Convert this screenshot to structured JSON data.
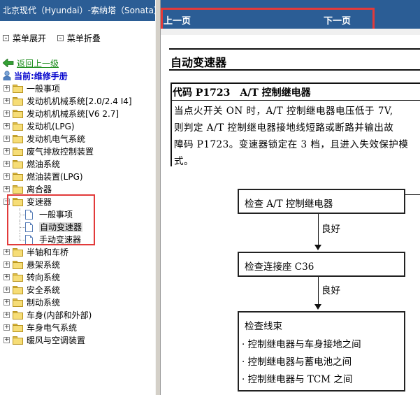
{
  "left_pane": {
    "title": "北京现代（Hyundai）-索纳塔（Sonata）-",
    "menu": {
      "expand_label": "菜单展开",
      "collapse_label": "菜单折叠"
    },
    "back_link": "返回上一级",
    "current_label": "当前:维修手册",
    "tree": [
      {
        "label": "一般事项",
        "expanded": false
      },
      {
        "label": "发动机机械系统[2.0/2.4 I4]",
        "expanded": false
      },
      {
        "label": "发动机机械系统[V6 2.7]",
        "expanded": false
      },
      {
        "label": "发动机(LPG)",
        "expanded": false
      },
      {
        "label": "发动机电气系统",
        "expanded": false
      },
      {
        "label": "废气排放控制装置",
        "expanded": false
      },
      {
        "label": "燃油系统",
        "expanded": false
      },
      {
        "label": "燃油装置(LPG)",
        "expanded": false
      },
      {
        "label": "离合器",
        "expanded": false
      },
      {
        "label": "变速器",
        "expanded": true,
        "children": [
          {
            "label": "一般事项",
            "selected": false
          },
          {
            "label": "自动变速器",
            "selected": true
          },
          {
            "label": "手动变速器",
            "selected": false
          }
        ]
      },
      {
        "label": "半轴和车桥",
        "expanded": false
      },
      {
        "label": "悬架系统",
        "expanded": false
      },
      {
        "label": "转向系统",
        "expanded": false
      },
      {
        "label": "安全系统",
        "expanded": false
      },
      {
        "label": "制动系统",
        "expanded": false
      },
      {
        "label": "车身(内部和外部)",
        "expanded": false
      },
      {
        "label": "车身电气系统",
        "expanded": false
      },
      {
        "label": "暖风与空调装置",
        "expanded": false
      }
    ]
  },
  "nav": {
    "prev_label": "上一页",
    "next_label": "下一页"
  },
  "document": {
    "section_title": "自动变速器",
    "code_title": "代码 P1723　A/T 控制继电器",
    "paragraph": [
      "当点火开关 ON 时，A/T 控制继电器电压低于 7V,",
      "则判定 A/T 控制继电器接地线短路或断路并输出故",
      "障码 P1723。变速器锁定在 3 档，且进入失效保护模",
      "式。"
    ],
    "flow": {
      "box1": "检查 A/T 控制继电器",
      "ok1": "良好",
      "box2": "检查连接座 C36",
      "ok2": "良好",
      "box3_title": "检查线束",
      "box3_items": [
        "· 控制继电器与车身接地之间",
        "· 控制继电器与蓄电池之间",
        "· 控制继电器与 TCM 之间"
      ]
    }
  },
  "colors": {
    "title_bar": "#2b5d95",
    "highlight": "#e23a3a",
    "back_link": "#1a8c1a",
    "current": "#0000cc"
  },
  "icons": [
    "expand-icon",
    "collapse-icon",
    "back-arrow-icon",
    "manual-icon",
    "folder-icon",
    "document-icon"
  ]
}
